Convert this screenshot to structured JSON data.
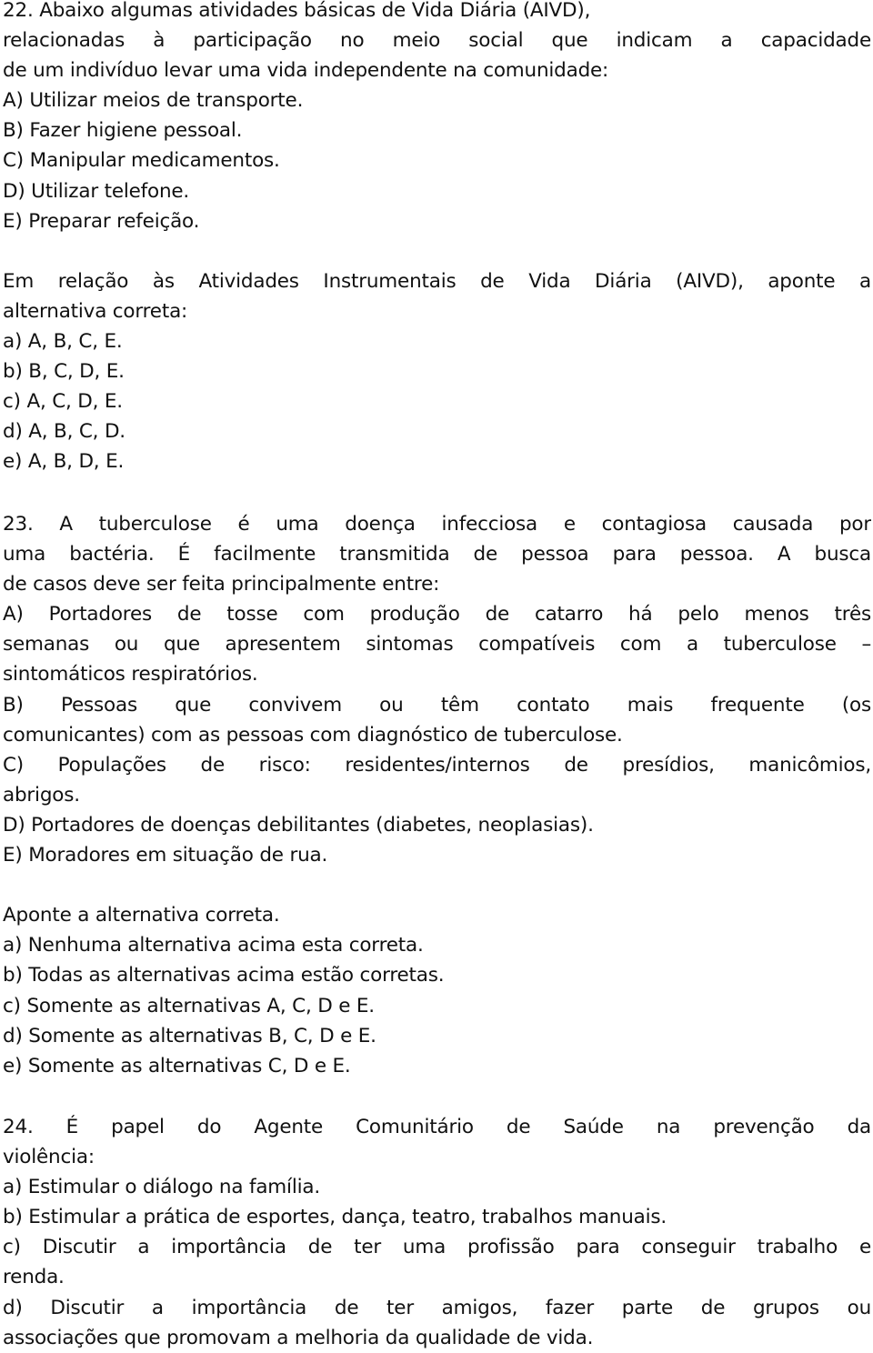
{
  "questions": [
    {
      "number": "22.",
      "stem_lines": [
        "22. Abaixo algumas atividades básicas de Vida Diária (AIVD),",
        "relacionadas à participação no meio social que indicam a capacidade",
        "de um indivíduo levar uma vida independente na comunidade:"
      ],
      "items": [
        "A) Utilizar meios de transporte.",
        "B) Fazer higiene pessoal.",
        "C) Manipular medicamentos.",
        "D) Utilizar telefone.",
        "E) Preparar refeição."
      ],
      "prompt_lines": [
        "Em relação às Atividades Instrumentais de Vida Diária (AIVD), aponte a",
        "alternativa correta:"
      ],
      "options": [
        "a) A, B, C, E.",
        "b) B, C, D, E.",
        "c) A, C, D, E.",
        "d) A, B, C, D.",
        "e) A, B, D, E."
      ]
    },
    {
      "number": "23.",
      "stem_lines": [
        "23. A tuberculose é uma doença infecciosa e contagiosa causada por",
        "uma bactéria. É facilmente transmitida de pessoa para pessoa. A busca",
        "de casos deve ser feita principalmente entre:"
      ],
      "items_lines": [
        "A) Portadores de tosse com produção de catarro há pelo menos três",
        "semanas ou que apresentem sintomas compatíveis com a tuberculose –",
        "sintomáticos respiratórios.",
        "B) Pessoas que convivem ou têm contato mais frequente (os",
        "comunicantes) com as pessoas com diagnóstico de tuberculose.",
        "C) Populações de risco: residentes/internos de presídios, manicômios,",
        "abrigos.",
        "D) Portadores de doenças debilitantes (diabetes, neoplasias).",
        "E) Moradores em situação de rua."
      ],
      "prompt": "Aponte a alternativa correta.",
      "options": [
        "a) Nenhuma alternativa acima esta correta.",
        "b) Todas as alternativas acima estão corretas.",
        "c) Somente as alternativas A, C, D e E.",
        "d) Somente as alternativas B, C, D e E.",
        "e) Somente as alternativas C, D e E."
      ]
    },
    {
      "number": "24.",
      "stem_lines": [
        "24. É papel do Agente Comunitário de Saúde na prevenção da",
        "violência:"
      ],
      "options_lines": [
        "a) Estimular o diálogo na família.",
        "b) Estimular a prática de esportes, dança, teatro, trabalhos manuais.",
        "c) Discutir a importância de ter uma profissão para conseguir trabalho e",
        "renda.",
        "d) Discutir a importância de ter amigos, fazer parte de grupos ou",
        "associações que promovam a melhoria da qualidade de vida."
      ]
    }
  ]
}
